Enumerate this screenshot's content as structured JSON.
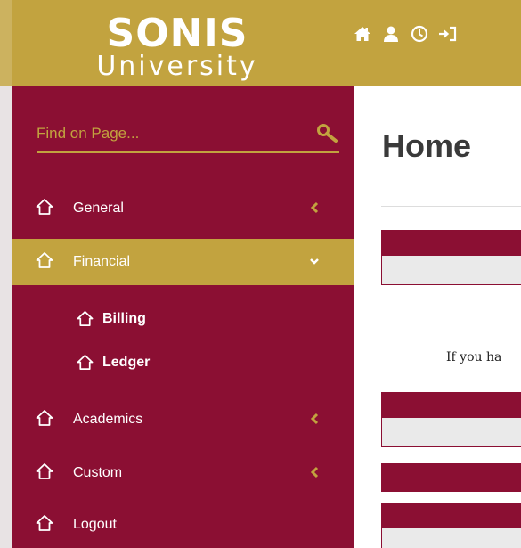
{
  "logo": {
    "main": "SONIS",
    "sub": "University"
  },
  "top_icons": [
    "home-icon",
    "user-icon",
    "clock-icon",
    "logout-icon"
  ],
  "colors": {
    "brand": "#8b0f33",
    "gold": "#c2a33f",
    "panel_body": "#eaeaea"
  },
  "search": {
    "placeholder": "Find on Page..."
  },
  "sidebar": {
    "items": [
      {
        "label": "General",
        "icon": "home-icon",
        "expandable": true
      },
      {
        "label": "Financial",
        "icon": "home-icon",
        "expanded": true,
        "active": true,
        "children": [
          {
            "label": "Billing"
          },
          {
            "label": "Ledger"
          }
        ]
      },
      {
        "label": "Academics",
        "icon": "home-icon",
        "expandable": true
      },
      {
        "label": "Custom",
        "icon": "home-icon",
        "expandable": true
      },
      {
        "label": "Logout",
        "icon": "home-icon"
      }
    ]
  },
  "main": {
    "title": "Home",
    "notice": "If you ha"
  }
}
